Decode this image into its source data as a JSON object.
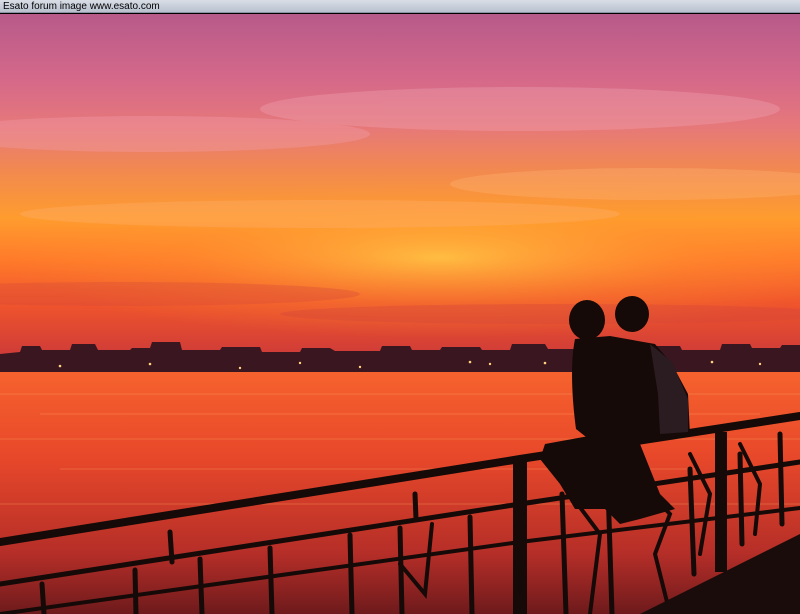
{
  "watermark": {
    "text": "Esato forum image www.esato.com"
  },
  "scene": {
    "description_colors": {
      "sky_top": "#c85d8e",
      "sky_mid": "#f07a4a",
      "sky_glow": "#ffb23a",
      "water": "#f2562a",
      "silhouette": "#150a08"
    }
  }
}
